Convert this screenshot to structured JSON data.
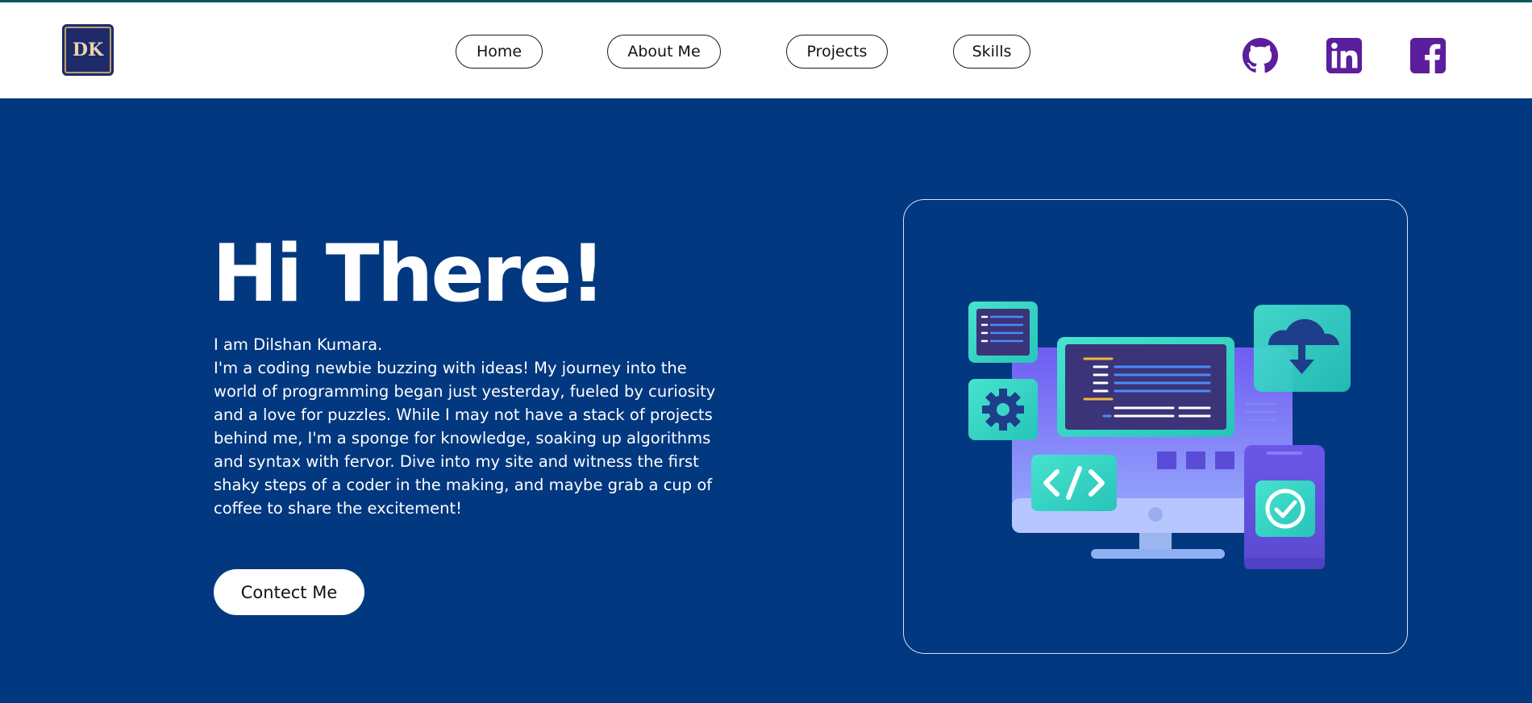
{
  "header": {
    "logo_text": "DK",
    "nav": [
      {
        "label": "Home"
      },
      {
        "label": "About Me"
      },
      {
        "label": "Projects"
      },
      {
        "label": "Skills"
      }
    ],
    "social": [
      "github-icon",
      "linkedin-icon",
      "facebook-icon"
    ],
    "colors": {
      "social": "#5b1e9c",
      "accent_border": "#0b5560"
    }
  },
  "hero": {
    "title": "Hi There!",
    "intro_line": "I am Dilshan Kumara.",
    "bio": "I'm a coding newbie buzzing with ideas! My journey into the world of programming began just yesterday, fueled by curiosity and a love for puzzles. While I may not have a stack of projects behind me, I'm a sponge for knowledge, soaking up algorithms and syntax with fervor. Dive into my site and witness the first shaky steps of a coder in the making, and maybe grab a cup of coffee to share the excitement!",
    "contact_label": "Contect Me"
  },
  "colors": {
    "background": "#013880",
    "header": "#ffffff"
  }
}
